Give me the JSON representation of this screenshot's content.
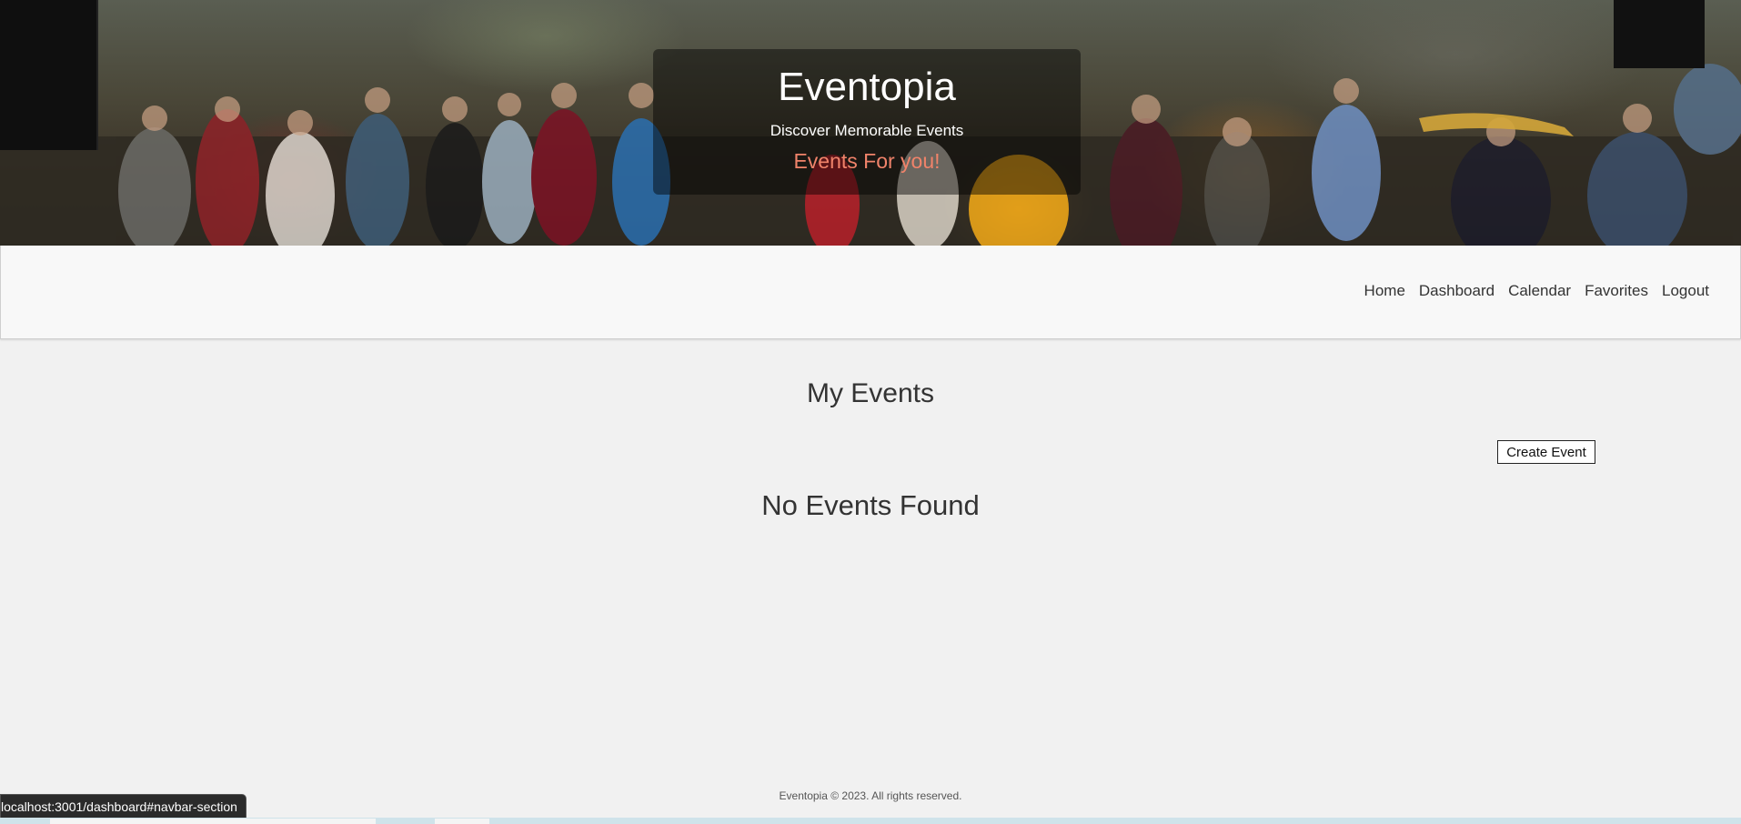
{
  "hero": {
    "title": "Eventopia",
    "subtitle": "Discover Memorable Events",
    "tagline": "Events For you!"
  },
  "nav": {
    "items": [
      {
        "label": "Home"
      },
      {
        "label": "Dashboard"
      },
      {
        "label": "Calendar"
      },
      {
        "label": "Favorites"
      },
      {
        "label": "Logout"
      }
    ]
  },
  "main": {
    "title": "My Events",
    "create_button_label": "Create Event",
    "empty_message": "No Events Found"
  },
  "footer": {
    "text": "Eventopia © 2023. All rights reserved."
  },
  "status_bar": {
    "url": "localhost:3001/dashboard#navbar-section"
  },
  "colors": {
    "page_background": "#f1f1f1",
    "navbar_background": "#f8f8f8",
    "tagline": "#f0836a",
    "hero_text": "#ffffff"
  }
}
